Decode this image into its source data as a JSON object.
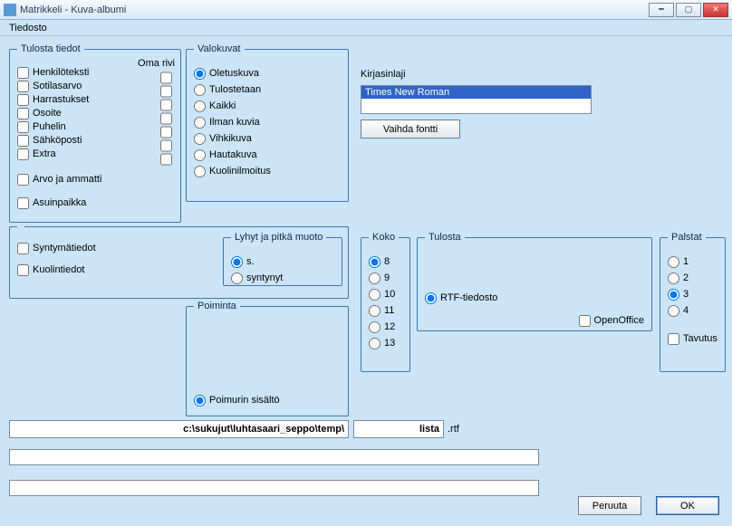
{
  "window": {
    "title": "Matrikkeli - Kuva-albumi"
  },
  "menu": {
    "file": "Tiedosto"
  },
  "group_tulosta": {
    "legend": "Tulosta tiedot",
    "oma_rivi": "Oma rivi",
    "items": {
      "henkiloteksti": "Henkilöteksti",
      "sotilasarvo": "Sotilasarvo",
      "harrastukset": "Harrastukset",
      "osoite": "Osoite",
      "puhelin": "Puhelin",
      "sahkoposti": "Sähköposti",
      "extra": "Extra",
      "arvo_ja_ammatti": "Arvo ja ammatti",
      "asuinpaikka": "Asuinpaikka"
    }
  },
  "syntymatiedot": "Syntymätiedot",
  "kuolintiedot": "Kuolintiedot",
  "group_valokuvat": {
    "legend": "Valokuvat",
    "items": {
      "oletuskuva": "Oletuskuva",
      "tulostetaan": "Tulostetaan",
      "kaikki": "Kaikki",
      "ilman_kuvia": "Ilman kuvia",
      "vihkikuva": "Vihkikuva",
      "hautakuva": "Hautakuva",
      "kuolinilmoitus": "Kuolinilmoitus"
    }
  },
  "kirjasinlaji": {
    "label": "Kirjasinlaji",
    "value": "Times New Roman",
    "button": "Vaihda fontti"
  },
  "group_lyhyt": {
    "legend": "Lyhyt ja pitkä muoto",
    "s": "s.",
    "syntynyt": "syntynyt"
  },
  "group_poiminta": {
    "legend": "Poiminta",
    "poimurin": "Poimurin sisältö"
  },
  "group_koko": {
    "legend": "Koko",
    "v8": "8",
    "v9": "9",
    "v10": "10",
    "v11": "11",
    "v12": "12",
    "v13": "13"
  },
  "group_tulosta2": {
    "legend": "Tulosta",
    "rtf": "RTF-tiedosto",
    "openoffice": "OpenOffice"
  },
  "group_palstat": {
    "legend": "Palstat",
    "p1": "1",
    "p2": "2",
    "p3": "3",
    "p4": "4",
    "tavutus": "Tavutus"
  },
  "path": {
    "folder": "c:\\sukujut\\luhtasaari_seppo\\temp\\",
    "name": "lista",
    "ext": ".rtf"
  },
  "buttons": {
    "cancel": "Peruuta",
    "ok": "OK"
  }
}
